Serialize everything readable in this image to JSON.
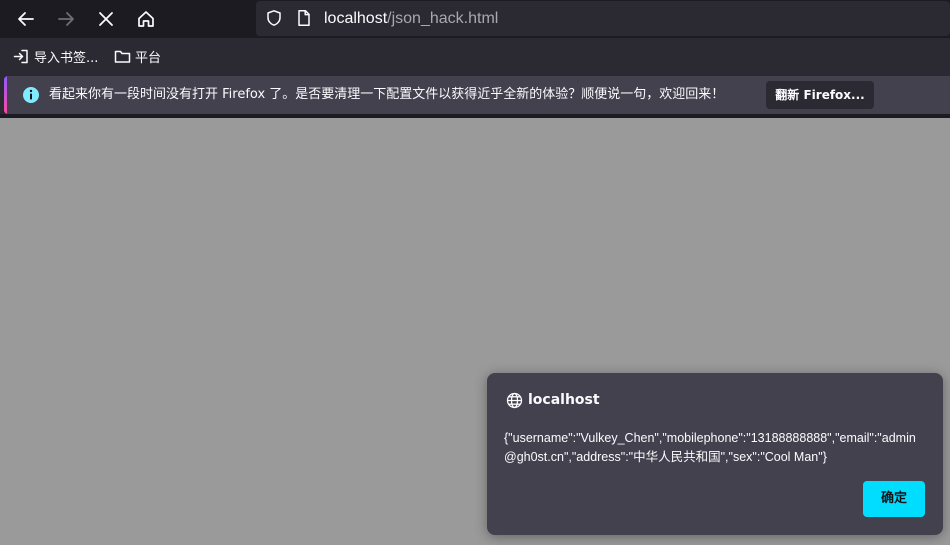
{
  "browser": {
    "nav": {
      "back_icon": "arrow-left-icon",
      "forward_icon": "arrow-right-icon",
      "stop_icon": "close-icon",
      "home_icon": "home-icon"
    },
    "urlbar": {
      "host": "localhost",
      "path": "/json_hack.html"
    },
    "bookmarks": [
      {
        "label": "导入书签...",
        "icon": "import-icon"
      },
      {
        "label": "平台",
        "icon": "folder-icon"
      }
    ],
    "notification": {
      "message": "看起来你有一段时间没有打开 Firefox 了。是否要清理一下配置文件以获得近乎全新的体验？顺便说一句，欢迎回来！",
      "button_label": "翻新 Firefox...",
      "icon": "info-icon"
    }
  },
  "dialog": {
    "title": "localhost",
    "title_icon": "globe-icon",
    "message": "{\"username\":\"Vulkey_Chen\",\"mobilephone\":\"13188888888\",\"email\":\"admin@gh0st.cn\",\"address\":\"中华人民共和国\",\"sex\":\"Cool Man\"}",
    "ok_label": "确定"
  },
  "colors": {
    "page_background": "#9a9a9a",
    "toolbar": "#1c1b22",
    "chrome": "#2b2a33",
    "notification": "#42414d",
    "accent": "#00ddff"
  }
}
